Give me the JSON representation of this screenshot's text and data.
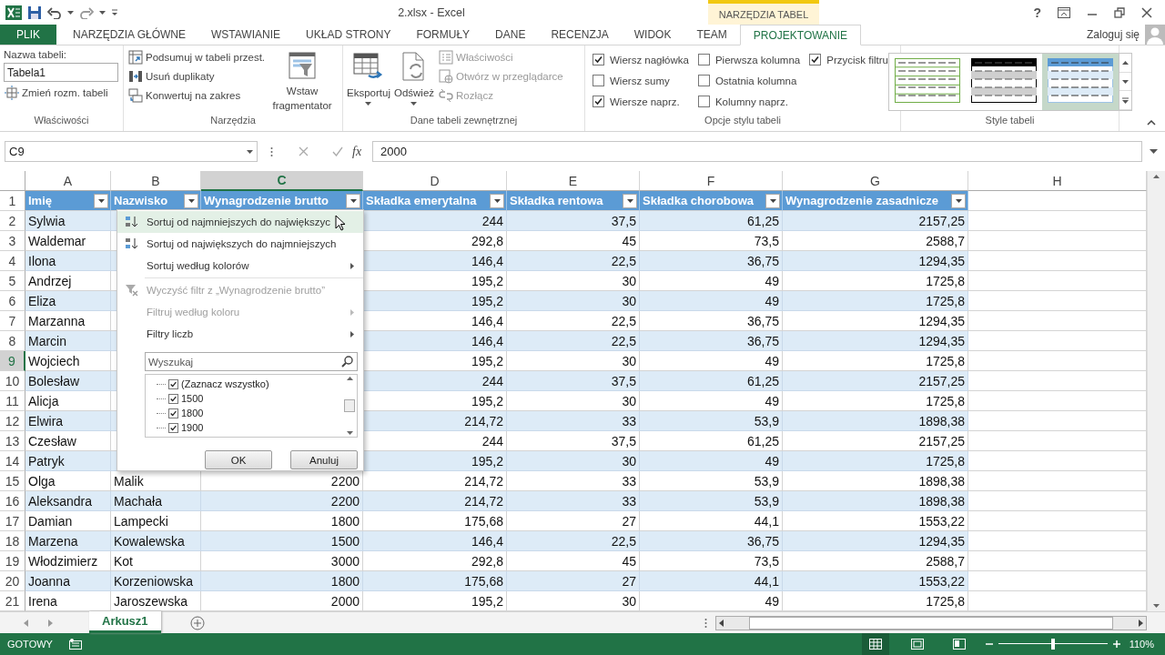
{
  "title_bar": {
    "title": "2.xlsx - Excel",
    "context_label": "NARZĘDZIA TABEL",
    "help": "?"
  },
  "tabs": [
    {
      "label": "PLIK",
      "kind": "file",
      "selected": false
    },
    {
      "label": "NARZĘDZIA GŁÓWNE",
      "kind": "normal",
      "selected": false
    },
    {
      "label": "WSTAWIANIE",
      "kind": "normal",
      "selected": false
    },
    {
      "label": "UKŁAD STRONY",
      "kind": "normal",
      "selected": false
    },
    {
      "label": "FORMUŁY",
      "kind": "normal",
      "selected": false
    },
    {
      "label": "DANE",
      "kind": "normal",
      "selected": false
    },
    {
      "label": "RECENZJA",
      "kind": "normal",
      "selected": false
    },
    {
      "label": "WIDOK",
      "kind": "normal",
      "selected": false
    },
    {
      "label": "TEAM",
      "kind": "normal",
      "selected": false
    },
    {
      "label": "PROJEKTOWANIE",
      "kind": "contextual",
      "selected": true
    }
  ],
  "account": "Zaloguj się",
  "ribbon": {
    "properties": {
      "caption": "Właściwości",
      "name_label": "Nazwa tabeli:",
      "name_value": "Tabela1",
      "resize": "Zmień rozm. tabeli"
    },
    "tools": {
      "caption": "Narzędzia",
      "buttons": [
        {
          "label": "Podsumuj w tabeli przest.",
          "kind": "pivot"
        },
        {
          "label": "Usuń duplikaty",
          "kind": "dedupe"
        },
        {
          "label": "Konwertuj na zakres",
          "kind": "convert"
        }
      ],
      "slicer": "Wstaw fragmentator"
    },
    "external": {
      "caption": "Dane tabeli zewnętrznej",
      "large": [
        {
          "label": "Eksportuj",
          "kind": "export"
        },
        {
          "label": "Odśwież",
          "kind": "refresh"
        }
      ],
      "small": [
        {
          "label": "Właściwości",
          "kind": "properties",
          "disabled": true
        },
        {
          "label": "Otwórz w przeglądarce",
          "kind": "browser",
          "disabled": true
        },
        {
          "label": "Rozłącz",
          "kind": "unlink",
          "disabled": true
        }
      ]
    },
    "style_options": {
      "caption": "Opcje stylu tabeli",
      "options": [
        {
          "label": "Wiersz nagłówka",
          "checked": true
        },
        {
          "label": "Wiersz sumy",
          "checked": false
        },
        {
          "label": "Wiersze naprz.",
          "checked": true
        },
        {
          "label": "Pierwsza kolumna",
          "checked": false
        },
        {
          "label": "Ostatnia kolumna",
          "checked": false
        },
        {
          "label": "Kolumny naprz.",
          "checked": false
        },
        {
          "label": "Przycisk filtru",
          "checked": true
        }
      ]
    },
    "table_styles": {
      "caption": "Style tabeli",
      "styles": [
        {
          "kind": "outline",
          "selected": false
        },
        {
          "kind": "dark",
          "selected": false
        },
        {
          "kind": "banded",
          "selected": true
        }
      ]
    }
  },
  "formula_bar": {
    "name_box": "C9",
    "fx": "fx",
    "value": "2000"
  },
  "columns": [
    {
      "letter": "A",
      "selected": false
    },
    {
      "letter": "B",
      "selected": false
    },
    {
      "letter": "C",
      "selected": true
    },
    {
      "letter": "D",
      "selected": false
    },
    {
      "letter": "E",
      "selected": false
    },
    {
      "letter": "F",
      "selected": false
    },
    {
      "letter": "G",
      "selected": false
    },
    {
      "letter": "H",
      "selected": false
    }
  ],
  "header_row": {
    "number": "1",
    "cells": [
      "Imię",
      "Nazwisko",
      "Wynagrodzenie brutto",
      "Składka emerytalna",
      "Składka rentowa",
      "Składka chorobowa",
      "Wynagrodzenie zasadnicze"
    ]
  },
  "rows": [
    {
      "number": "2",
      "selected": false,
      "cells": [
        "Sylwia",
        null,
        null,
        "244",
        "37,5",
        "61,25",
        "2157,25"
      ]
    },
    {
      "number": "3",
      "selected": false,
      "cells": [
        "Waldemar",
        null,
        null,
        "292,8",
        "45",
        "73,5",
        "2588,7"
      ]
    },
    {
      "number": "4",
      "selected": false,
      "cells": [
        "Ilona",
        null,
        null,
        "146,4",
        "22,5",
        "36,75",
        "1294,35"
      ]
    },
    {
      "number": "5",
      "selected": false,
      "cells": [
        "Andrzej",
        null,
        null,
        "195,2",
        "30",
        "49",
        "1725,8"
      ]
    },
    {
      "number": "6",
      "selected": false,
      "cells": [
        "Eliza",
        null,
        null,
        "195,2",
        "30",
        "49",
        "1725,8"
      ]
    },
    {
      "number": "7",
      "selected": false,
      "cells": [
        "Marzanna",
        null,
        null,
        "146,4",
        "22,5",
        "36,75",
        "1294,35"
      ]
    },
    {
      "number": "8",
      "selected": false,
      "cells": [
        "Marcin",
        null,
        null,
        "146,4",
        "22,5",
        "36,75",
        "1294,35"
      ]
    },
    {
      "number": "9",
      "selected": true,
      "cells": [
        "Wojciech",
        null,
        null,
        "195,2",
        "30",
        "49",
        "1725,8"
      ]
    },
    {
      "number": "10",
      "selected": false,
      "cells": [
        "Bolesław",
        null,
        null,
        "244",
        "37,5",
        "61,25",
        "2157,25"
      ]
    },
    {
      "number": "11",
      "selected": false,
      "cells": [
        "Alicja",
        null,
        null,
        "195,2",
        "30",
        "49",
        "1725,8"
      ]
    },
    {
      "number": "12",
      "selected": false,
      "cells": [
        "Elwira",
        null,
        null,
        "214,72",
        "33",
        "53,9",
        "1898,38"
      ]
    },
    {
      "number": "13",
      "selected": false,
      "cells": [
        "Czesław",
        null,
        null,
        "244",
        "37,5",
        "61,25",
        "2157,25"
      ]
    },
    {
      "number": "14",
      "selected": false,
      "cells": [
        "Patryk",
        null,
        null,
        "195,2",
        "30",
        "49",
        "1725,8"
      ]
    },
    {
      "number": "15",
      "selected": false,
      "cells": [
        "Olga",
        "Malik",
        "2200",
        "214,72",
        "33",
        "53,9",
        "1898,38"
      ]
    },
    {
      "number": "16",
      "selected": false,
      "cells": [
        "Aleksandra",
        "Machała",
        "2200",
        "214,72",
        "33",
        "53,9",
        "1898,38"
      ]
    },
    {
      "number": "17",
      "selected": false,
      "cells": [
        "Damian",
        "Lampecki",
        "1800",
        "175,68",
        "27",
        "44,1",
        "1553,22"
      ]
    },
    {
      "number": "18",
      "selected": false,
      "cells": [
        "Marzena",
        "Kowalewska",
        "1500",
        "146,4",
        "22,5",
        "36,75",
        "1294,35"
      ]
    },
    {
      "number": "19",
      "selected": false,
      "cells": [
        "Włodzimierz",
        "Kot",
        "3000",
        "292,8",
        "45",
        "73,5",
        "2588,7"
      ]
    },
    {
      "number": "20",
      "selected": false,
      "cells": [
        "Joanna",
        "Korzeniowska",
        "1800",
        "175,68",
        "27",
        "44,1",
        "1553,22"
      ]
    },
    {
      "number": "21",
      "selected": false,
      "cells": [
        "Irena",
        "Jaroszewska",
        "2000",
        "195,2",
        "30",
        "49",
        "1725,8"
      ]
    }
  ],
  "filter_menu": {
    "items": [
      {
        "label": "Sortuj od najmniejszych do największyc",
        "kind": "sort-asc",
        "disabled": false,
        "submenu": false,
        "selected": true
      },
      {
        "label": "Sortuj od największych do najmniejszych",
        "kind": "sort-desc",
        "disabled": false,
        "submenu": false,
        "selected": false
      },
      {
        "label": "Sortuj według kolorów",
        "kind": "plain",
        "disabled": false,
        "submenu": true,
        "selected": false
      },
      {
        "label": "Wyczyść filtr z „Wynagrodzenie brutto”",
        "kind": "clear-filter",
        "disabled": true,
        "submenu": false,
        "selected": false
      },
      {
        "label": "Filtruj według koloru",
        "kind": "plain",
        "disabled": true,
        "submenu": true,
        "selected": false
      },
      {
        "label": "Filtry liczb",
        "kind": "plain",
        "disabled": false,
        "submenu": true,
        "selected": false
      }
    ],
    "search": {
      "placeholder": "Wyszukaj"
    },
    "values": [
      {
        "label": "(Zaznacz wszystko)",
        "checked": true
      },
      {
        "label": "1500",
        "checked": true
      },
      {
        "label": "1800",
        "checked": true
      },
      {
        "label": "1900",
        "checked": true
      }
    ],
    "buttons": [
      "OK",
      "Anuluj"
    ]
  },
  "sheets": [
    {
      "label": "Arkusz1",
      "selected": true
    }
  ],
  "status_bar": {
    "status": "GOTOWY",
    "zoom": {
      "level": 0.5,
      "reading": "110%"
    }
  }
}
